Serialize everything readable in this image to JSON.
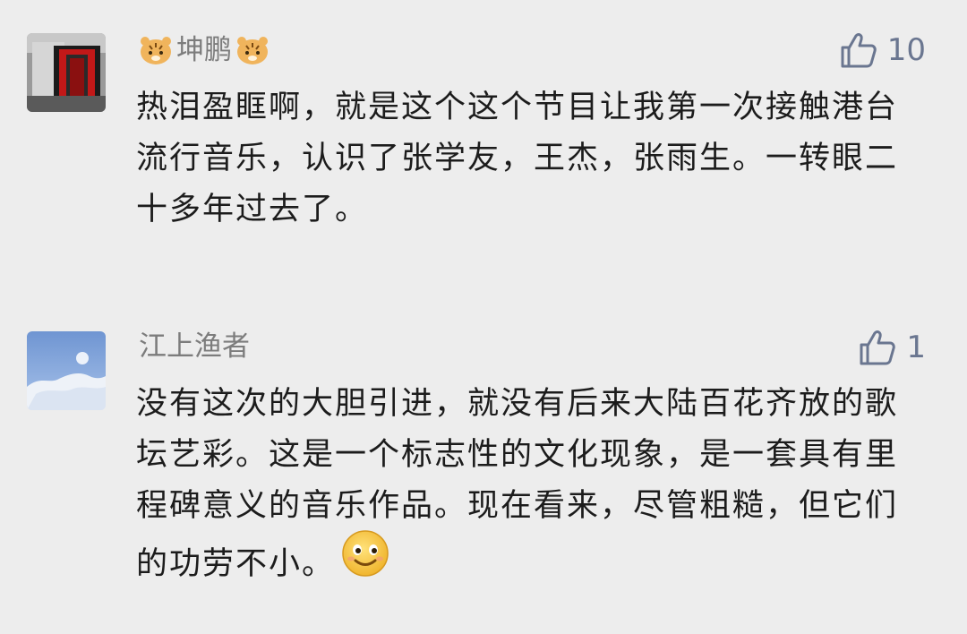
{
  "comments": [
    {
      "username": "坤鹏",
      "like_count": "10",
      "text": "热泪盈眶啊，就是这个这个节目让我第一次接触港台流行音乐，认识了张学友，王杰，张雨生。一转眼二十多年过去了。"
    },
    {
      "username": "江上渔者",
      "like_count": "1",
      "text": "没有这次的大胆引进，就没有后来大陆百花齐放的歌坛艺彩。这是一个标志性的文化现象，是一套具有里程碑意义的音乐作品。现在看来，尽管粗糙，但它们的功劳不小。"
    }
  ],
  "icons": {
    "like": "thumbs-up-icon",
    "deco": "tiger-emoji-icon",
    "emoji": "smile-emoji-icon"
  },
  "colors": {
    "background": "#ededed",
    "username": "#7c7c7c",
    "like": "#6a7690",
    "text": "#1c1c1c",
    "emoji": "#f4c53a"
  }
}
